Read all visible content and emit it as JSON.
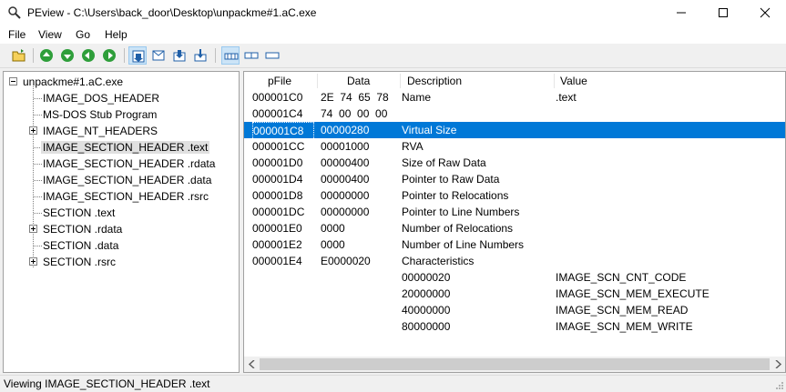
{
  "window": {
    "title": "PEview - C:\\Users\\back_door\\Desktop\\unpackme#1.aC.exe"
  },
  "menu": {
    "items": [
      "File",
      "View",
      "Go",
      "Help"
    ]
  },
  "toolbar": {
    "buttons": [
      "open-icon",
      "back-icon",
      "forward-icon",
      "previous-icon",
      "next-icon",
      "view-byte-icon",
      "view-word-icon",
      "view-dword-icon",
      "view-qword-icon",
      "layout-1-icon",
      "layout-2-icon",
      "layout-3-icon"
    ]
  },
  "tree": {
    "root": "unpackme#1.aC.exe",
    "items": [
      "IMAGE_DOS_HEADER",
      "MS-DOS Stub Program",
      "IMAGE_NT_HEADERS",
      "IMAGE_SECTION_HEADER .text",
      "IMAGE_SECTION_HEADER .rdata",
      "IMAGE_SECTION_HEADER .data",
      "IMAGE_SECTION_HEADER .rsrc",
      "SECTION .text",
      "SECTION .rdata",
      "SECTION .data",
      "SECTION .rsrc"
    ],
    "selected": "IMAGE_SECTION_HEADER .text"
  },
  "table": {
    "headers": [
      "pFile",
      "Data",
      "Description",
      "Value"
    ],
    "rows": [
      {
        "pfile": "000001C0",
        "data": "2E  74  65  78",
        "desc": "Name",
        "value": ".text"
      },
      {
        "pfile": "000001C4",
        "data": "74  00  00  00",
        "desc": "",
        "value": ""
      },
      {
        "pfile": "000001C8",
        "data": "00000280",
        "desc": "Virtual Size",
        "value": ""
      },
      {
        "pfile": "000001CC",
        "data": "00001000",
        "desc": "RVA",
        "value": ""
      },
      {
        "pfile": "000001D0",
        "data": "00000400",
        "desc": "Size of Raw Data",
        "value": ""
      },
      {
        "pfile": "000001D4",
        "data": "00000400",
        "desc": "Pointer to Raw Data",
        "value": ""
      },
      {
        "pfile": "000001D8",
        "data": "00000000",
        "desc": "Pointer to Relocations",
        "value": ""
      },
      {
        "pfile": "000001DC",
        "data": "00000000",
        "desc": "Pointer to Line Numbers",
        "value": ""
      },
      {
        "pfile": "000001E0",
        "data": "0000",
        "desc": "Number of Relocations",
        "value": ""
      },
      {
        "pfile": "000001E2",
        "data": "0000",
        "desc": "Number of Line Numbers",
        "value": ""
      },
      {
        "pfile": "000001E4",
        "data": "E0000020",
        "desc": "Characteristics",
        "value": ""
      },
      {
        "pfile": "",
        "data": "",
        "desc": "00000020",
        "value": "IMAGE_SCN_CNT_CODE"
      },
      {
        "pfile": "",
        "data": "",
        "desc": "20000000",
        "value": "IMAGE_SCN_MEM_EXECUTE"
      },
      {
        "pfile": "",
        "data": "",
        "desc": "40000000",
        "value": "IMAGE_SCN_MEM_READ"
      },
      {
        "pfile": "",
        "data": "",
        "desc": "80000000",
        "value": "IMAGE_SCN_MEM_WRITE"
      }
    ],
    "selected_pfile": "000001C8"
  },
  "status": {
    "text": "Viewing IMAGE_SECTION_HEADER .text"
  },
  "colors": {
    "selection": "#0078d7",
    "toolbar_pressed": "#cce4f7"
  }
}
